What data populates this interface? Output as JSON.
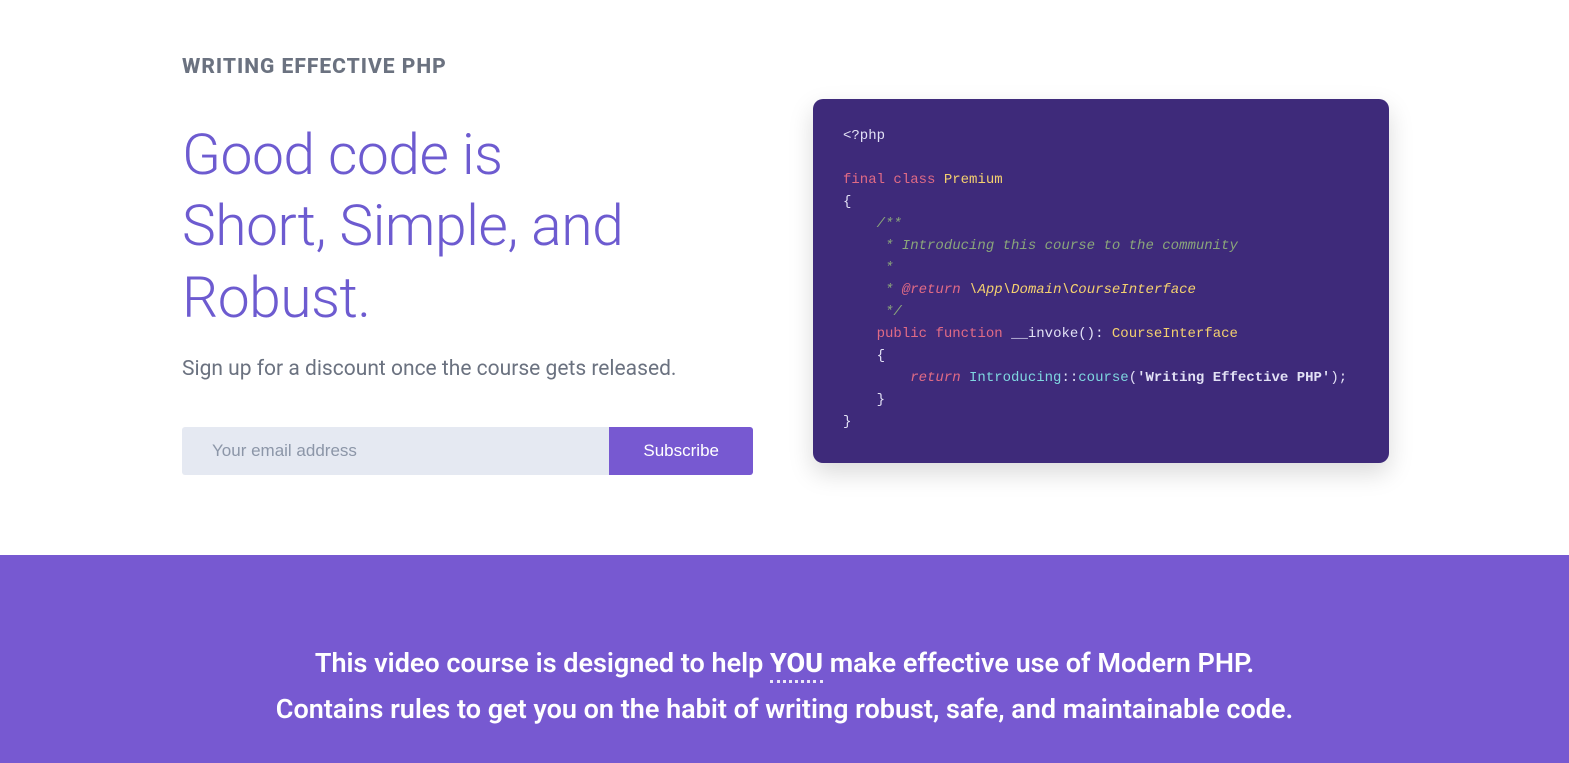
{
  "hero": {
    "eyebrow": "WRITING EFFECTIVE PHP",
    "headline_line1": "Good code is",
    "headline_line2": "Short, Simple, and Robust.",
    "tagline": "Sign up for a discount once the course gets released.",
    "email_placeholder": "Your email address",
    "subscribe_label": "Subscribe"
  },
  "code": {
    "open_tag": "<?php",
    "kw_final": "final",
    "kw_class": "class",
    "class_name": "Premium",
    "brace_open": "{",
    "doc_open": "    /**",
    "doc_line1": "     * Introducing this course to the community",
    "doc_blank": "     *",
    "doc_ret_prefix": "     * ",
    "anno_return": "@return",
    "ns_sep": " \\",
    "ns_app": "App",
    "ns_domain": "Domain",
    "ns_iface": "CourseInterface",
    "doc_close": "     */",
    "kw_public": "public",
    "kw_function": "function",
    "method_name": "__invoke",
    "paren_colon": "(): ",
    "ret_type": "CourseInterface",
    "method_brace_open": "    {",
    "kw_return": "        return",
    "static_class": " Introducing",
    "static_sep": "::",
    "static_method": "course",
    "string_open": "(",
    "string_val": "'Writing Effective PHP'",
    "string_close": ");",
    "method_brace_close": "    }",
    "brace_close": "}"
  },
  "cta": {
    "line1_pre": "This video course is designed to help ",
    "line1_you": "YOU",
    "line1_post": " make effective use of Modern PHP.",
    "line2": "Contains rules to get you on the habit of writing robust, safe, and maintainable code."
  }
}
